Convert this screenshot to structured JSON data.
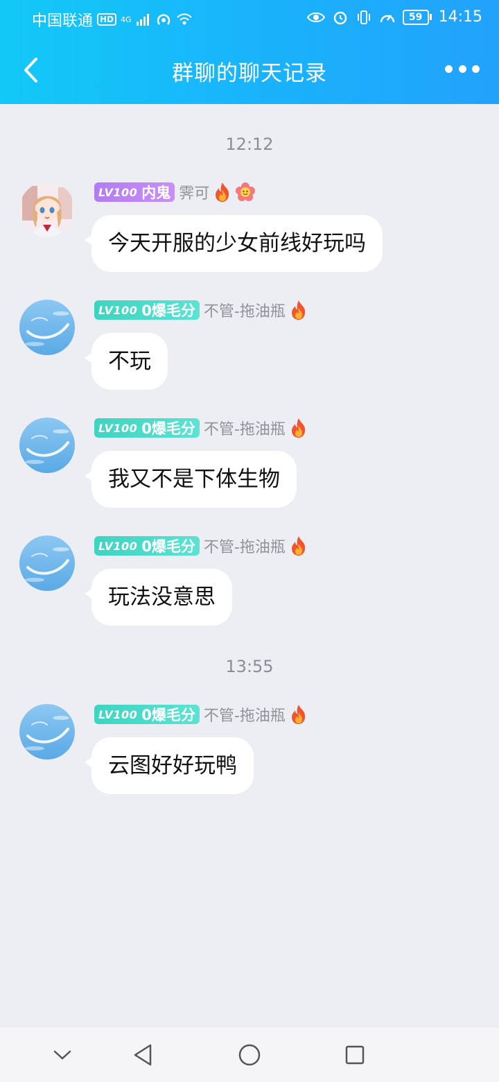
{
  "status_bar": {
    "carrier": "中国联通",
    "hd": "HD",
    "net": "4G",
    "battery": "59",
    "time": "14:15"
  },
  "header": {
    "title": "群聊的聊天记录"
  },
  "colors": {
    "header_start": "#12c9f7",
    "header_end": "#22a2fb",
    "background": "#eceef4",
    "badge_purple": "#b27cf5",
    "badge_teal": "#3dd5c0"
  },
  "timestamps": [
    "12:12",
    "13:55"
  ],
  "messages": [
    {
      "level": "LV100",
      "title": "内鬼",
      "name": "霁可",
      "text": "今天开服的少女前线好玩吗",
      "avatar": "anime-girl-avatar"
    },
    {
      "level": "LV100",
      "title": "0爆毛分",
      "name": "不管-拖油瓶",
      "text": "不玩",
      "avatar": "sky-cloud-avatar"
    },
    {
      "level": "LV100",
      "title": "0爆毛分",
      "name": "不管-拖油瓶",
      "text": "我又不是下体生物",
      "avatar": "sky-cloud-avatar"
    },
    {
      "level": "LV100",
      "title": "0爆毛分",
      "name": "不管-拖油瓶",
      "text": "玩法没意思",
      "avatar": "sky-cloud-avatar"
    },
    {
      "level": "LV100",
      "title": "0爆毛分",
      "name": "不管-拖油瓶",
      "text": "云图好好玩鸭",
      "avatar": "sky-cloud-avatar"
    }
  ],
  "icons": [
    "back-arrow-icon",
    "more-dots-icon",
    "flame-icon",
    "flower-icon",
    "nav-down-icon",
    "nav-back-icon",
    "nav-home-icon",
    "nav-recents-icon"
  ]
}
